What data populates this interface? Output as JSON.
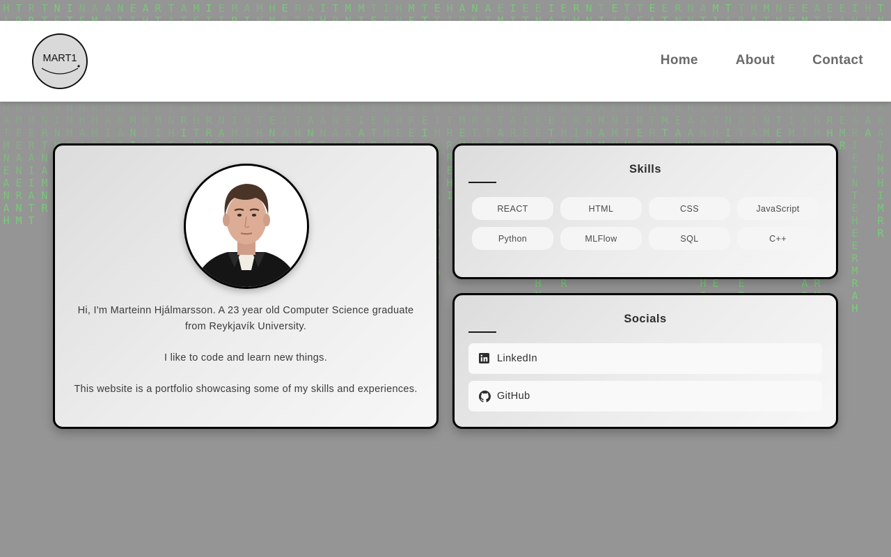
{
  "logo": {
    "text": "MART1"
  },
  "nav": {
    "items": [
      {
        "label": "Home"
      },
      {
        "label": "About"
      },
      {
        "label": "Contact"
      }
    ]
  },
  "profile": {
    "photo_alt": "portrait-photo",
    "bio": [
      "Hi, I'm Marteinn Hjálmarsson. A 23 year old Computer Science graduate from Reykjavík University.",
      "I like to code and learn new things.",
      "This website is a portfolio showcasing some of my skills and experiences."
    ]
  },
  "skills": {
    "title": "Skills",
    "items": [
      "REACT",
      "HTML",
      "CSS",
      "JavaScript",
      "Python",
      "MLFlow",
      "SQL",
      "C++"
    ]
  },
  "socials": {
    "title": "Socials",
    "items": [
      {
        "label": "LinkedIn",
        "icon": "linkedin-icon"
      },
      {
        "label": "GitHub",
        "icon": "github-icon"
      }
    ]
  },
  "colors": {
    "background": "#959595",
    "matrix_glyph": "#6fdc6f",
    "card_border": "#000000",
    "header_bg": "#ffffff",
    "nav_text": "#6a6a6a"
  }
}
